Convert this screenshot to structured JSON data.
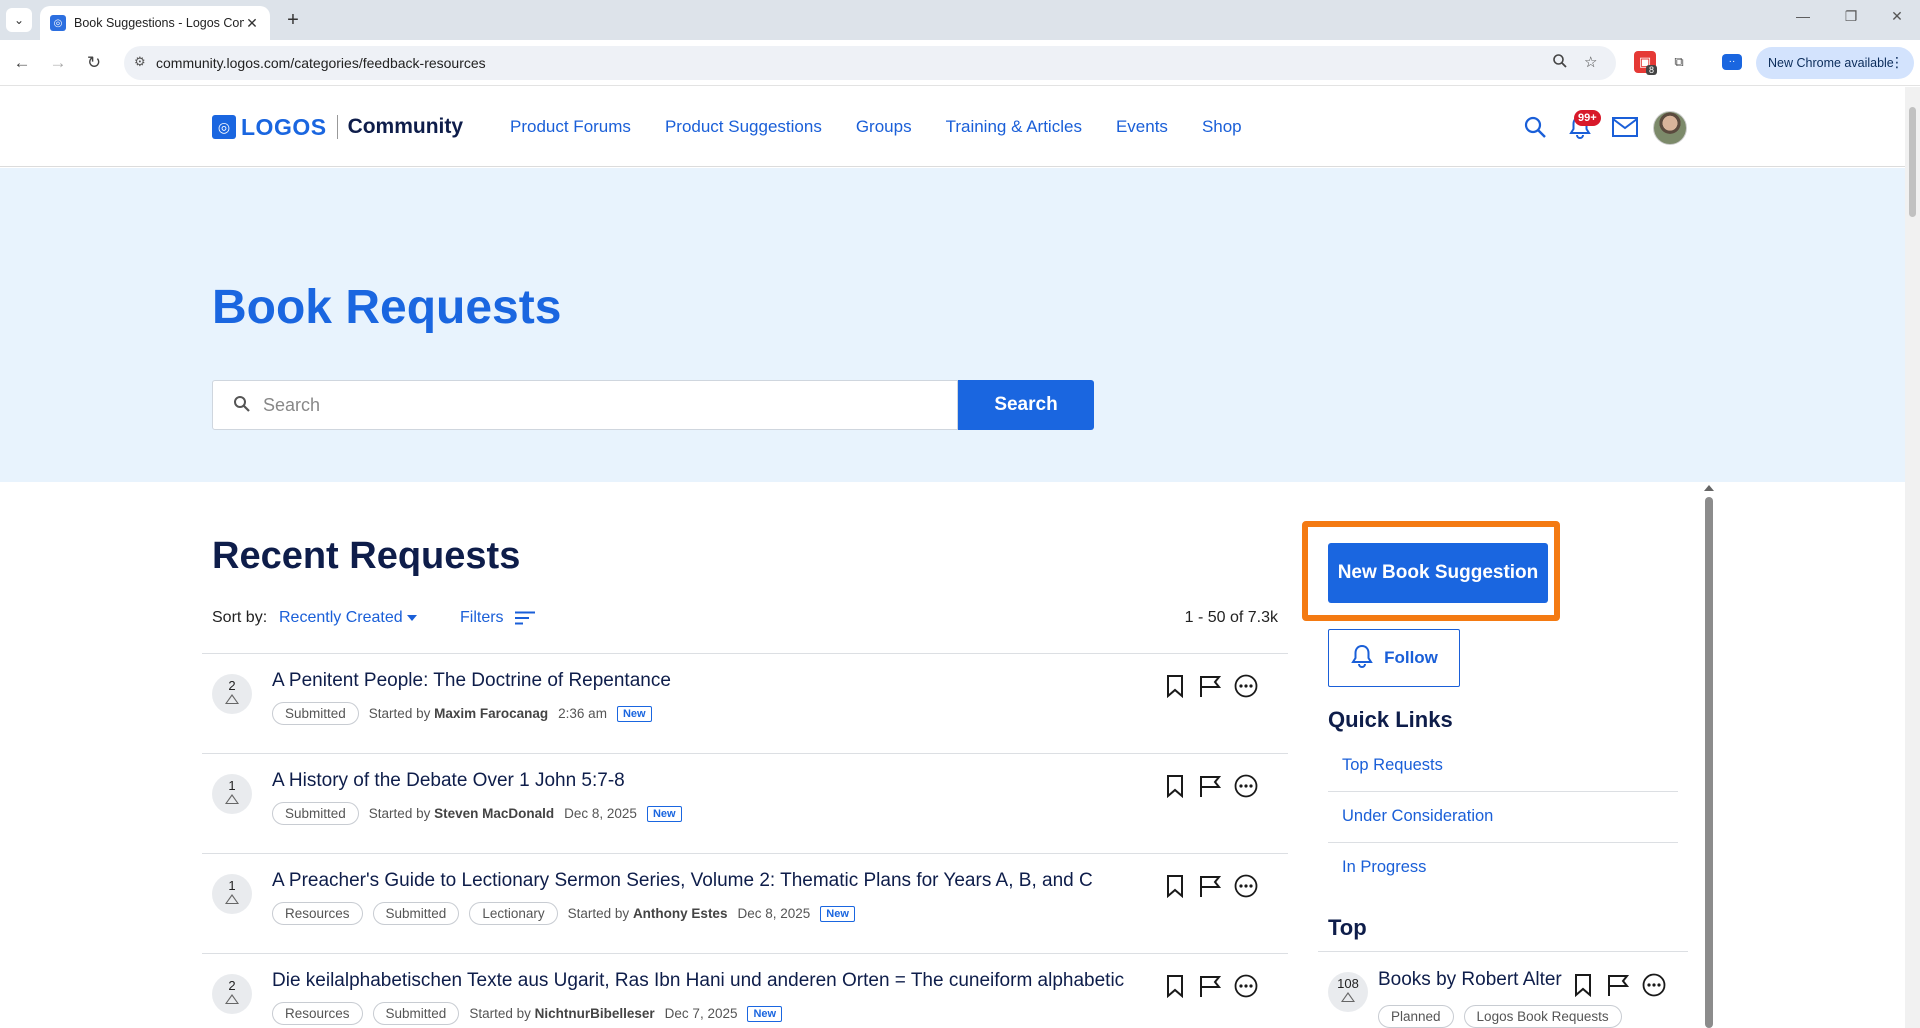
{
  "browser": {
    "tab_title": "Book Suggestions - Logos Com",
    "url": "community.logos.com/categories/feedback-resources",
    "update_label": "New Chrome available",
    "extension_badge": "8"
  },
  "header": {
    "logo_text": "LOGOS",
    "community_text": "Community",
    "nav": [
      "Product Forums",
      "Product Suggestions",
      "Groups",
      "Training & Articles",
      "Events",
      "Shop"
    ],
    "notification_badge": "99+"
  },
  "hero": {
    "title": "Book Requests",
    "search_placeholder": "Search",
    "search_button": "Search"
  },
  "main": {
    "title": "Recent Requests",
    "sort_label": "Sort by:",
    "sort_value": "Recently Created",
    "filters_label": "Filters",
    "count": "1 - 50 of 7.3k",
    "rows": [
      {
        "votes": "2",
        "title": "A Penitent People: The Doctrine of Repentance",
        "tags": [
          "Submitted"
        ],
        "started_by": "Started by",
        "author": "Maxim Farocanag",
        "time": "2:36 am",
        "badge": "New"
      },
      {
        "votes": "1",
        "title": "A History of the Debate Over 1 John 5:7-8",
        "tags": [
          "Submitted"
        ],
        "started_by": "Started by",
        "author": "Steven MacDonald",
        "time": "Dec 8, 2025",
        "badge": "New"
      },
      {
        "votes": "1",
        "title": "A Preacher's Guide to Lectionary Sermon Series, Volume 2: Thematic Plans for Years A, B, and C",
        "tags": [
          "Resources",
          "Submitted",
          "Lectionary"
        ],
        "started_by": "Started by",
        "author": "Anthony Estes",
        "time": "Dec 8, 2025",
        "badge": "New"
      },
      {
        "votes": "2",
        "title": "Die keilalphabetischen Texte aus Ugarit, Ras Ibn Hani und anderen Orten = The cuneiform alphabetic",
        "tags": [
          "Resources",
          "Submitted"
        ],
        "started_by": "Started by",
        "author": "NichtnurBibelleser",
        "time": "Dec 7, 2025",
        "badge": "New"
      }
    ]
  },
  "sidebar": {
    "new_button": "New Book Suggestion",
    "follow_button": "Follow",
    "quick_links_title": "Quick Links",
    "quick_links": [
      "Top Requests",
      "Under Consideration",
      "In Progress"
    ],
    "top_title": "Top",
    "top_item": {
      "votes": "108",
      "title": "Books by Robert Alter",
      "tags": [
        "Planned",
        "Logos Book Requests"
      ]
    }
  },
  "colors": {
    "accent": "#1a66e0",
    "hero_bg": "#e8f3fd",
    "heading": "#0e1d4a",
    "highlight": "#f47a12",
    "badge_red": "#d8192a"
  }
}
